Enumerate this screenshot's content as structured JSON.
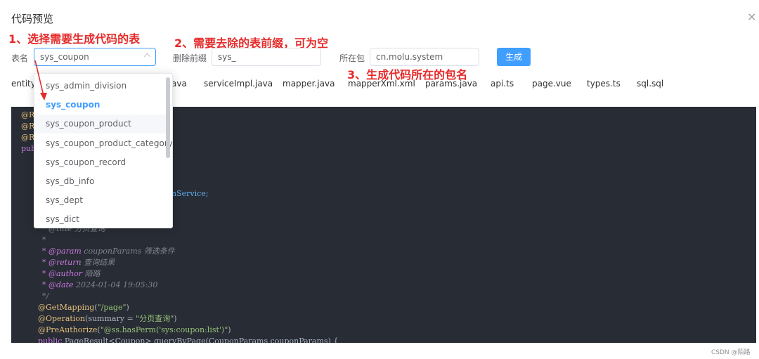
{
  "dialog": {
    "title": "代码预览",
    "close_icon": "close-icon",
    "close_glyph": "×"
  },
  "annotations": {
    "a1": "1、选择需要生成代码的表",
    "a2": "2、需要去除的表前缀，可为空",
    "a3": "3、生成代码所在的包名",
    "color": "#e62b2b"
  },
  "form": {
    "table_label": "表名",
    "table_value": "sys_coupon",
    "prefix_label": "删除前缀",
    "prefix_value": "sys_",
    "package_label": "所在包",
    "package_value": "cn.molu.system",
    "generate_label": "生成"
  },
  "dropdown": {
    "items": [
      "sys_admin_division",
      "sys_coupon",
      "sys_coupon_product",
      "sys_coupon_product_category",
      "sys_coupon_record",
      "sys_db_info",
      "sys_dept",
      "sys_dict"
    ],
    "selected": "sys_coupon",
    "hovered": "sys_coupon_product"
  },
  "tabs": {
    "t0": "entity.j",
    "t1": "ava",
    "t2": "serviceImpl.java",
    "t3": "mapper.java",
    "t4": "mapperXml.xml",
    "t5": "params.java",
    "t6": "api.ts",
    "t7": "page.vue",
    "t8": "types.ts",
    "t9": "sql.sql"
  },
  "code": {
    "left_frag1": "@Re",
    "left_frag2": "@Re",
    "left_frag3": "@Re",
    "left_frag4": "pub",
    "svc_frag": "nService;",
    "title_frag": "* @title 分页查询",
    "star": "*",
    "param_tag": "* @param",
    "param_text": " couponParams 筛选条件",
    "return_tag": "* @return",
    "return_text": " 查询结果",
    "author_tag": "* @author",
    "author_text": " 陌路",
    "date_tag": "* @date",
    "date_text": " 2024-01-04 19:05:30",
    "close_comment": "*/",
    "getmapping_ann": "@GetMapping",
    "getmapping_str": "\"/page\"",
    "operation_ann": "@Operation",
    "operation_mid": "(summary = ",
    "operation_str": "\"分页查询\"",
    "preauth_ann": "@PreAuthorize",
    "preauth_str": "\"@ss.hasPerm('sys:coupon:list')\"",
    "sig_kw": "public",
    "sig_rest": " PageResult<Coupon> queryByPage(CouponParams couponParams) {"
  },
  "colors": {
    "accent": "#409eff",
    "code_bg": "#282c34",
    "annotation_red": "#e62b2b"
  },
  "watermark": "CSDN @陌路"
}
